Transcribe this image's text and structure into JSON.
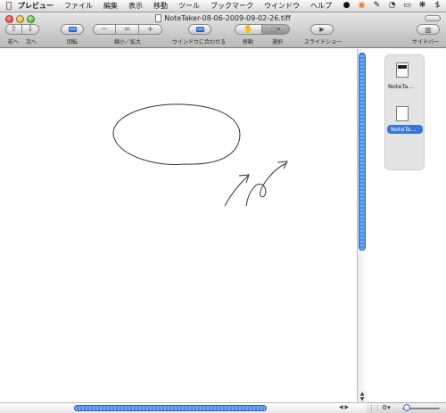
{
  "menubar": {
    "app_name": "プレビュー",
    "items": [
      "ファイル",
      "編集",
      "表示",
      "移動",
      "ツール",
      "ブックマーク",
      "ウインドウ",
      "ヘルプ"
    ]
  },
  "window": {
    "title": "NoteTaker-08-06-2009-09-02-26.tiff"
  },
  "toolbar": {
    "prev_label": "前へ",
    "next_label": "次へ",
    "rotate_label": "回転",
    "zoom_label": "縮小／拡大",
    "zoom_out_symbol": "−",
    "zoom_actual_symbol": "=",
    "zoom_in_symbol": "+",
    "fit_window_label": "ウインドウに合わせる",
    "move_label": "移動",
    "select_label": "選択",
    "slideshow_label": "スライドショー",
    "sidebar_label": "サイドバー"
  },
  "drawer": {
    "thumbnails": [
      {
        "label": "NoteTa...",
        "selected": false
      },
      {
        "label": "NoteTa...",
        "selected": true
      }
    ]
  },
  "colors": {
    "selection_blue": "#3b77d9",
    "scroll_blue": "#5a9bec"
  }
}
